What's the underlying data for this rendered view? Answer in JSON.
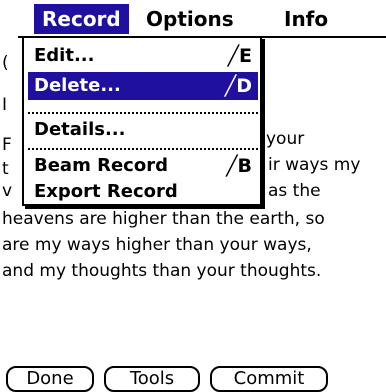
{
  "menubar": {
    "items": [
      {
        "label": "Record",
        "active": true
      },
      {
        "label": "Options",
        "active": false
      },
      {
        "label": "Info",
        "active": false
      }
    ]
  },
  "dropdown": {
    "items": [
      {
        "label": "Edit...",
        "shortcut": "╱E",
        "highlight": false
      },
      {
        "label": "Delete...",
        "shortcut": "╱D",
        "highlight": true
      },
      {
        "label": "Details...",
        "shortcut": "",
        "highlight": false
      },
      {
        "label": "Beam Record",
        "shortcut": "╱B",
        "highlight": false
      },
      {
        "label": "Export Record",
        "shortcut": "",
        "highlight": false
      }
    ]
  },
  "note": {
    "partial_lines": [
      "your",
      "ir ways my",
      "as the"
    ],
    "full_lines": [
      "heavens are higher than the earth, so",
      "are my ways higher than your ways,",
      "and my thoughts than your thoughts."
    ],
    "left_fragments": [
      "(",
      "I",
      "F",
      "t",
      "v"
    ]
  },
  "buttons": {
    "done": "Done",
    "tools": "Tools",
    "commit": "Commit"
  },
  "colors": {
    "highlight": "#1f10a0",
    "text": "#000000",
    "background": "#ffffff"
  }
}
